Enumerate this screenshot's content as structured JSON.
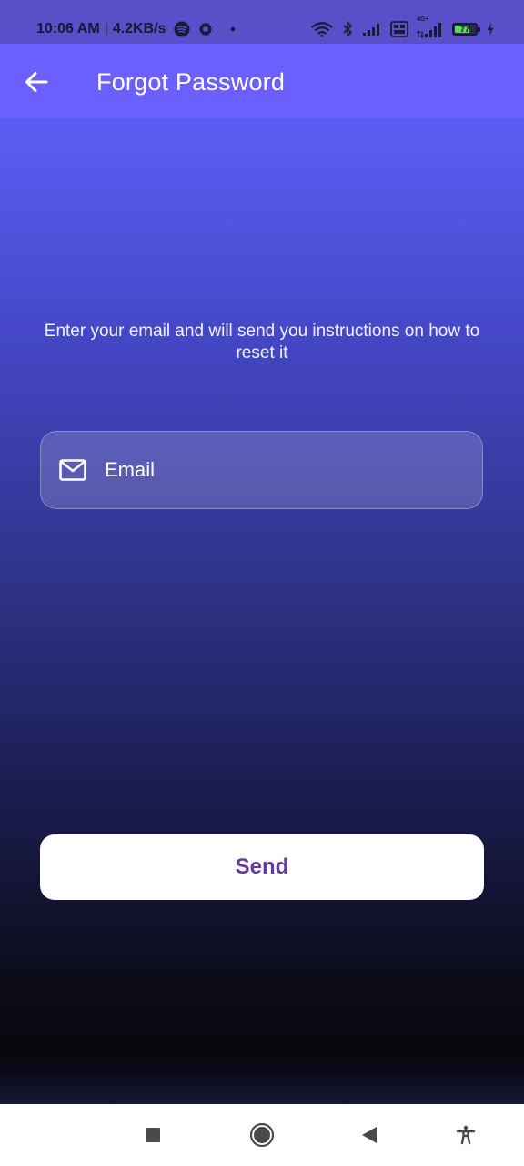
{
  "status_bar": {
    "time": "10:06 AM",
    "separator": "|",
    "network_speed": "4.2KB/s",
    "battery_level": "77",
    "battery_fraction": 0.77,
    "network_label": "4G+",
    "icons": [
      "spotify-icon",
      "gear-icon",
      "dot-icon",
      "wifi-icon",
      "bluetooth-icon",
      "signal-icon",
      "volte-icon",
      "signal-4g-icon",
      "battery-icon",
      "charging-icon"
    ]
  },
  "app_bar": {
    "title": "Forgot Password",
    "back_icon": "arrow-left-icon",
    "background": "#6c5fff"
  },
  "content": {
    "instructions": "Enter your email and will send you instructions on how to reset it",
    "email_placeholder": "Email",
    "email_value": "",
    "email_icon": "mail-icon",
    "send_label": "Send",
    "send_color": "#653a9f"
  },
  "nav_bar": {
    "icons": [
      "recents-square-icon",
      "home-circle-icon",
      "back-triangle-icon",
      "accessibility-icon"
    ]
  }
}
